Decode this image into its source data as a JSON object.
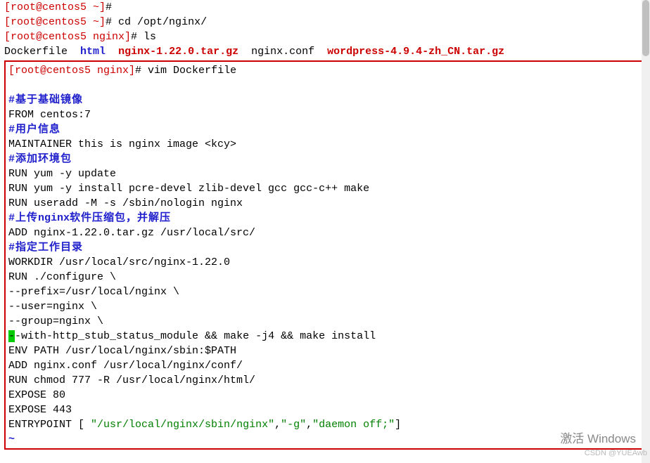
{
  "prompts": {
    "p0_user": "[root@centos5 ~]",
    "p0_sym": "#",
    "p1_user": "[root@centos5 ~]",
    "p1_sym": "#",
    "p1_cmd": " cd /opt/nginx/",
    "p2_user": "[root@centos5 nginx]",
    "p2_sym": "#",
    "p2_cmd": " ls",
    "p3_user": "[root@centos5 nginx]",
    "p3_sym": "#",
    "p3_cmd": " vim Dockerfile"
  },
  "ls": {
    "f1": "Dockerfile",
    "sp1": "  ",
    "f2": "html",
    "sp2": "  ",
    "f3": "nginx-1.22.0.tar.gz",
    "sp3": "  ",
    "f4": "nginx.conf",
    "sp4": "  ",
    "f5": "wordpress-4.9.4-zh_CN.tar.gz"
  },
  "dockerfile": {
    "l01": "#基于基础镜像",
    "l02": "FROM centos:7",
    "l03": "#用户信息",
    "l04": "MAINTAINER this is nginx image <kcy>",
    "l05": "#添加环境包",
    "l06": "RUN yum -y update",
    "l07": "RUN yum -y install pcre-devel zlib-devel gcc gcc-c++ make",
    "l08": "RUN useradd -M -s /sbin/nologin nginx",
    "l09a": "#上传",
    "l09b": "nginx",
    "l09c": "软件压缩包，并解压",
    "l10": "ADD nginx-1.22.0.tar.gz /usr/local/src/",
    "l11": "#指定工作目录",
    "l12": "WORKDIR /usr/local/src/nginx-1.22.0",
    "l13": "RUN ./configure \\",
    "l14": "--prefix=/usr/local/nginx \\",
    "l15": "--user=nginx \\",
    "l16": "--group=nginx \\",
    "l17cursor": "-",
    "l17rest": "-with-http_stub_status_module && make -j4 && make install",
    "l18": "ENV PATH /usr/local/nginx/sbin:$PATH",
    "l19": "ADD nginx.conf /usr/local/nginx/conf/",
    "l20": "RUN chmod 777 -R /usr/local/nginx/html/",
    "l21": "EXPOSE 80",
    "l22": "EXPOSE 443",
    "l23a": "ENTRYPOINT [ ",
    "l23b": "\"/usr/local/nginx/sbin/nginx\"",
    "l23c": ",",
    "l23d": "\"-g\"",
    "l23e": ",",
    "l23f": "\"daemon off;\"",
    "l23g": "]",
    "tilde": "~"
  },
  "watermarks": {
    "win": "激活 Windows",
    "csdn": "CSDN @YUEAwb"
  }
}
